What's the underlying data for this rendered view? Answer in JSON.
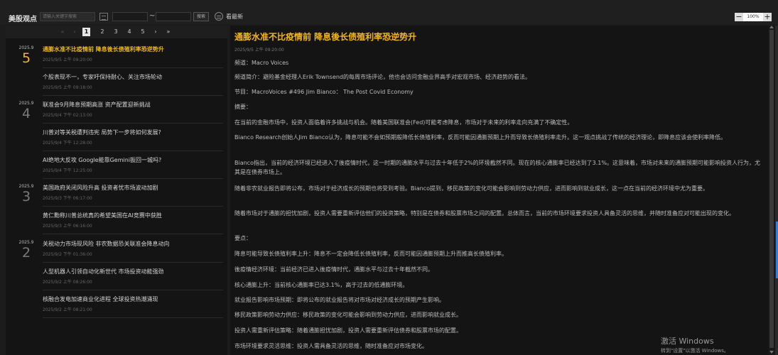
{
  "app": {
    "title": "美股观点"
  },
  "toolbar": {
    "search_placeholder": "请输入关键字搜索",
    "date_separator": "~",
    "search_label": "搜索",
    "latest_label": "看最新",
    "zoom_out": "−",
    "zoom_level": "100%",
    "zoom_in": "+"
  },
  "pagination": {
    "first": "«",
    "prev": "‹",
    "pages": [
      "1",
      "2",
      "3",
      "4",
      "5"
    ],
    "current": "1",
    "next": "›",
    "last": "»"
  },
  "groups": [
    {
      "month": "2025.9",
      "day": "5"
    },
    {
      "month": "2025.9",
      "day": "4"
    },
    {
      "month": "2025.9",
      "day": "3"
    },
    {
      "month": "2025.9",
      "day": "2"
    }
  ],
  "articles": [
    {
      "title": "通膨水准不比疫情前 降息後长债殖利率恐逆势升",
      "time": "2025/9/5 上午 09:20:00",
      "selected": true
    },
    {
      "title": "个股表现不一，专家吁保持耐心、关注市场轮动",
      "time": "2025/9/5 上午 09:18:00"
    },
    {
      "title": "联准会9月降息预期高涨 资产配置迎新挑战",
      "time": "2025/9/4 下午 02:13:00"
    },
    {
      "title": "川普对等关税遭判违宪 局势下一步将如何发展?",
      "time": "2025/9/4 下午 12:28:00"
    },
    {
      "title": "AI绝地大反攻 Google能靠Gemini扳回一城吗?",
      "time": "2025/9/4 下午 12:25:00"
    },
    {
      "title": "美国政府关闭风险升高 投资者忧市场波动加剧",
      "time": "2025/9/3 下午 06:17:00"
    },
    {
      "title": "黄仁勳称川普总统真的希望美国在AI竞赛中获胜",
      "time": "2025/9/3 上午 06:16:00"
    },
    {
      "title": "关税动力市场现风险 非农数据恐关联准会降息动向",
      "time": "2025/9/2 下午 01:36:00"
    },
    {
      "title": "人型机器人引领自动化新世代 市场投资动能强劲",
      "time": "2025/9/2 上午 08:26:00"
    },
    {
      "title": "核融合发电加速商业化进程 全球投资热潮涌现",
      "time": "2025/9/2 上午 08:21:00"
    }
  ],
  "article": {
    "title": "通膨水准不比疫情前 降息後长债殖利率恐逆势升",
    "time": "2025/9/5 上午 09:20:00",
    "paragraphs": [
      "频道：Macro Voices",
      "频道简介：避险基金经理人Erik Townsend的每周市场评论，他也会访问金融业界高手对宏观市场、经济趋势的看法。",
      "节目：MacroVoices #496 Jim Bianco： The Post Covid Economy",
      "摘要：",
      "在当前的金融市场中，投资人面临着许多挑战与机会。随着美国联准会(Fed)可能考虑降息，市场对于未来的利率走向充满了不确定性。",
      "Bianco Research创始人Jim Bianco认为，降息可能不会如预期般降低长债殖利率，反而可能因通膨预期上升而导致长债殖利率走升。这一观点挑战了传统的经济理论，即降息应该会使利率降低。",
      "Bianco指出，当前的经济环境已经进入了後疫情时代，这一时期的通膨水平与过去十年低于2%的环境截然不同。现在的核心通膨率已经达到了3.1%。这意味着，市场对未来的通膨预期可能影响投资人行为，尤其是在债券市场上。",
      "随着非农就业报告即将公布，市场对于经济成长的预期也将受到考验。Bianco提到，移民政策的变化可能会影响到劳动力供应，进而影响到就业成长，这一点在当前的经济环境中尤为重要。",
      "随着市场对于通膨的担忧加剧，投资人需要重新评估他们的投资策略，特别是在债券和股票市场之间的配置。总体而言，当前的市场环境要求投资人具备灵活的思维，并随时准备应对可能出现的变化。",
      "要点：",
      "降息可能导致长债殖利率上升：降息不一定会降低长债殖利率，反而可能因通膨预期上升而推高长债殖利率。",
      "後疫情经济环境：当前经济已进入後疫情时代，通膨水平与过去十年截然不同。",
      "核心通膨上升：当前核心通膨率已达3.1%，高于过去的低通膨环境。",
      "就业报告影响市场预期：即将公布的就业报告将对市场对经济成长的预期产生影响。",
      "移民政策影响劳动力供应：移民政策的变化可能会影响到劳动力供应，进而影响就业成长。",
      "投资人需重新评估策略：随着通膨担忧加剧，投资人需要重新评估债券和股票市场的配置。",
      "市场环境要求灵活思维：投资人需具备灵活的思维，随时准备应对市场变化。"
    ]
  },
  "watermark": {
    "title": "激活 Windows",
    "subtitle": "转到\"设置\"以激活 Windows。"
  },
  "colors": {
    "accent": "#f2b61c",
    "background": "#141414",
    "text": "#bdbdbd"
  }
}
